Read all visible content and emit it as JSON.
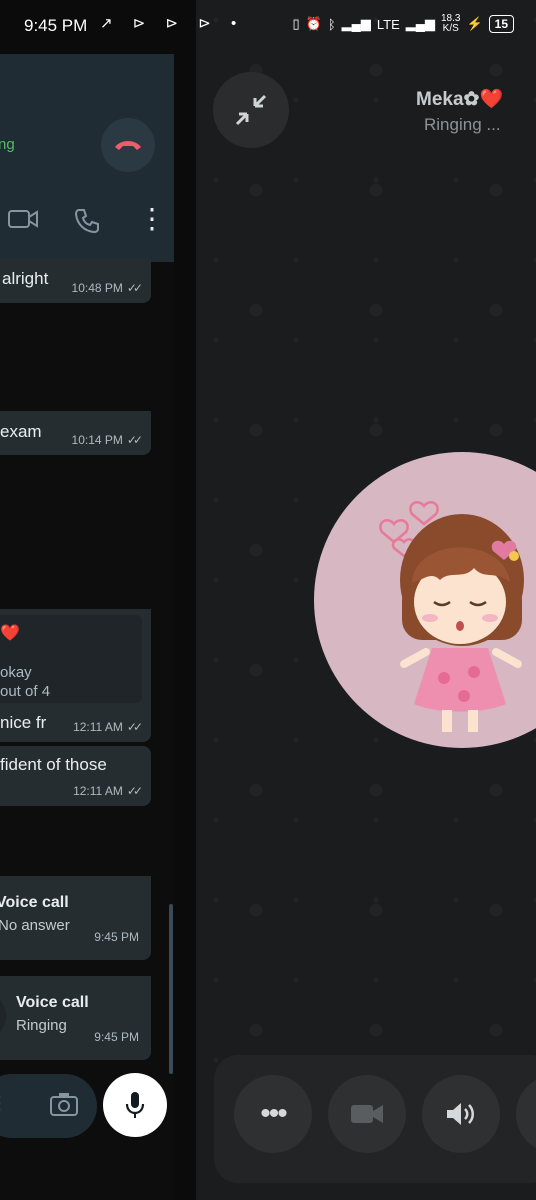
{
  "status_bar": {
    "time": "9:45 PM",
    "network": "LTE",
    "speed": "18.3",
    "speed_unit": "K/S",
    "battery": "15"
  },
  "ongoing_call": {
    "status_fragment": "ng"
  },
  "chat": {
    "messages": [
      {
        "text": "alright",
        "time": "10:48 PM"
      },
      {
        "text": "exam",
        "time": "10:14 PM"
      },
      {
        "reply_line1": "okay",
        "reply_line2": "out of 4",
        "text": "nice fr",
        "time": "12:11 AM"
      },
      {
        "text": "fident of those",
        "time": "12:11 AM"
      }
    ],
    "calls": [
      {
        "title": "Voice call",
        "status": "No answer",
        "time": "9:45 PM"
      },
      {
        "title": "Voice call",
        "status": "Ringing",
        "time": "9:45 PM"
      }
    ]
  },
  "call_screen": {
    "caller_name": "Meka✿❤️",
    "call_status": "Ringing ..."
  },
  "colors": {
    "accent_green": "#53bd6b",
    "end_call_red": "#f15c6d"
  }
}
